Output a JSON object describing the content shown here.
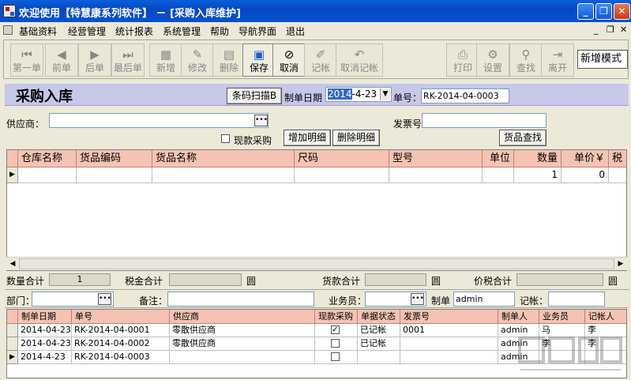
{
  "window": {
    "title": "欢迎使用【特慧康系列软件】 － [采购入库维护]"
  },
  "menu": [
    "基础资料",
    "经营管理",
    "统计报表",
    "系统管理",
    "帮助",
    "导航界面",
    "退出"
  ],
  "toolbar": {
    "first": "第一单",
    "prev": "前单",
    "next": "后单",
    "last": "最后单",
    "add": "新增",
    "edit": "修改",
    "delete": "删除",
    "save": "保存",
    "cancel": "取消",
    "post": "记帐",
    "unpost": "取消记帐",
    "print": "打印",
    "settings": "设置",
    "find": "查找",
    "exit": "离开",
    "mode": "新增模式"
  },
  "form": {
    "title": "采购入库",
    "barcode_button": "条码扫描B",
    "date_label": "制单日期",
    "date_value": "2014-4-23",
    "date_sel": "2014",
    "date_rest": "-4-23",
    "no_label": "单号：",
    "no_value": "RK-2014-04-0003",
    "supplier_label": "供应商：",
    "supplier_value": "",
    "invoice_label": "发票号",
    "invoice_value": "",
    "cash_purchase_label": "现款采购",
    "cash_purchase_checked": false,
    "add_detail": "增加明细",
    "remove_detail": "删除明细",
    "goods_search": "货品查找"
  },
  "detail_grid": {
    "columns": [
      "仓库名称",
      "货品编码",
      "货品名称",
      "尺码",
      "型号",
      "单位",
      "数量",
      "单价￥",
      "税"
    ],
    "rows": [
      {
        "warehouse": "",
        "code": "",
        "name": "",
        "size": "",
        "model": "",
        "unit": "",
        "qty": "1",
        "price": "0",
        "tax": ""
      }
    ]
  },
  "totals": {
    "qty_label": "数量合计",
    "qty_value": "1",
    "tax_label": "税金合计",
    "tax_value": "",
    "tax_unit": "圆",
    "goods_label": "货款合计",
    "goods_value": "",
    "goods_unit": "圆",
    "gross_label": "价税合计",
    "gross_value": "",
    "gross_unit": "圆"
  },
  "filter": {
    "dept_label": "部门：",
    "dept_value": "",
    "remark_label": "备注：",
    "remark_value": "",
    "staff_label": "业务员：",
    "staff_value": "",
    "maker_label": "制单",
    "maker_value": "admin",
    "poster_label": "记帐：",
    "poster_value": ""
  },
  "list_grid": {
    "columns": [
      "制单日期",
      "单号",
      "供应商",
      "现款采购",
      "单据状态",
      "发票号",
      "制单人",
      "业务员",
      "记帐人"
    ],
    "rows": [
      {
        "date": "2014-04-23",
        "no": "RK-2014-04-0001",
        "supplier": "零散供应商",
        "cash": true,
        "status": "已记帐",
        "invoice": "0001",
        "maker": "admin",
        "staff": "马",
        "poster": "李"
      },
      {
        "date": "2014-04-23",
        "no": "RK-2014-04-0002",
        "supplier": "零散供应商",
        "cash": false,
        "status": "已记帐",
        "invoice": "",
        "maker": "admin",
        "staff": "李",
        "poster": "李"
      },
      {
        "date": "2014-4-23",
        "no": "RK-2014-04-0003",
        "supplier": "",
        "cash": false,
        "status": "",
        "invoice": "",
        "maker": "admin",
        "staff": "",
        "poster": ""
      }
    ]
  }
}
